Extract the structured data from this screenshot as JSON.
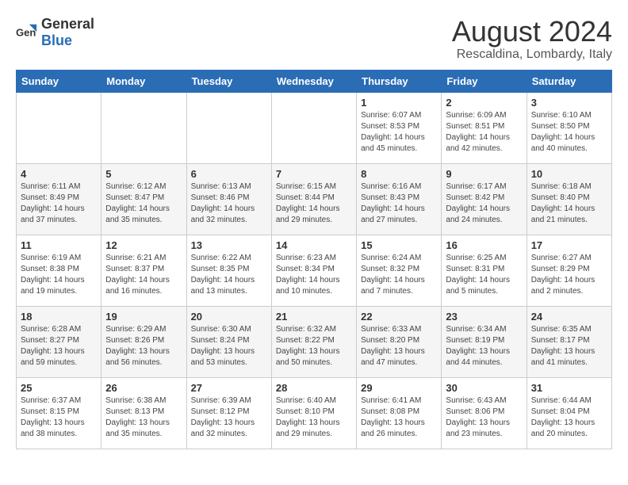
{
  "logo": {
    "general": "General",
    "blue": "Blue"
  },
  "title": "August 2024",
  "location": "Rescaldina, Lombardy, Italy",
  "days_header": [
    "Sunday",
    "Monday",
    "Tuesday",
    "Wednesday",
    "Thursday",
    "Friday",
    "Saturday"
  ],
  "weeks": [
    [
      {
        "day": "",
        "info": ""
      },
      {
        "day": "",
        "info": ""
      },
      {
        "day": "",
        "info": ""
      },
      {
        "day": "",
        "info": ""
      },
      {
        "day": "1",
        "info": "Sunrise: 6:07 AM\nSunset: 8:53 PM\nDaylight: 14 hours\nand 45 minutes."
      },
      {
        "day": "2",
        "info": "Sunrise: 6:09 AM\nSunset: 8:51 PM\nDaylight: 14 hours\nand 42 minutes."
      },
      {
        "day": "3",
        "info": "Sunrise: 6:10 AM\nSunset: 8:50 PM\nDaylight: 14 hours\nand 40 minutes."
      }
    ],
    [
      {
        "day": "4",
        "info": "Sunrise: 6:11 AM\nSunset: 8:49 PM\nDaylight: 14 hours\nand 37 minutes."
      },
      {
        "day": "5",
        "info": "Sunrise: 6:12 AM\nSunset: 8:47 PM\nDaylight: 14 hours\nand 35 minutes."
      },
      {
        "day": "6",
        "info": "Sunrise: 6:13 AM\nSunset: 8:46 PM\nDaylight: 14 hours\nand 32 minutes."
      },
      {
        "day": "7",
        "info": "Sunrise: 6:15 AM\nSunset: 8:44 PM\nDaylight: 14 hours\nand 29 minutes."
      },
      {
        "day": "8",
        "info": "Sunrise: 6:16 AM\nSunset: 8:43 PM\nDaylight: 14 hours\nand 27 minutes."
      },
      {
        "day": "9",
        "info": "Sunrise: 6:17 AM\nSunset: 8:42 PM\nDaylight: 14 hours\nand 24 minutes."
      },
      {
        "day": "10",
        "info": "Sunrise: 6:18 AM\nSunset: 8:40 PM\nDaylight: 14 hours\nand 21 minutes."
      }
    ],
    [
      {
        "day": "11",
        "info": "Sunrise: 6:19 AM\nSunset: 8:38 PM\nDaylight: 14 hours\nand 19 minutes."
      },
      {
        "day": "12",
        "info": "Sunrise: 6:21 AM\nSunset: 8:37 PM\nDaylight: 14 hours\nand 16 minutes."
      },
      {
        "day": "13",
        "info": "Sunrise: 6:22 AM\nSunset: 8:35 PM\nDaylight: 14 hours\nand 13 minutes."
      },
      {
        "day": "14",
        "info": "Sunrise: 6:23 AM\nSunset: 8:34 PM\nDaylight: 14 hours\nand 10 minutes."
      },
      {
        "day": "15",
        "info": "Sunrise: 6:24 AM\nSunset: 8:32 PM\nDaylight: 14 hours\nand 7 minutes."
      },
      {
        "day": "16",
        "info": "Sunrise: 6:25 AM\nSunset: 8:31 PM\nDaylight: 14 hours\nand 5 minutes."
      },
      {
        "day": "17",
        "info": "Sunrise: 6:27 AM\nSunset: 8:29 PM\nDaylight: 14 hours\nand 2 minutes."
      }
    ],
    [
      {
        "day": "18",
        "info": "Sunrise: 6:28 AM\nSunset: 8:27 PM\nDaylight: 13 hours\nand 59 minutes."
      },
      {
        "day": "19",
        "info": "Sunrise: 6:29 AM\nSunset: 8:26 PM\nDaylight: 13 hours\nand 56 minutes."
      },
      {
        "day": "20",
        "info": "Sunrise: 6:30 AM\nSunset: 8:24 PM\nDaylight: 13 hours\nand 53 minutes."
      },
      {
        "day": "21",
        "info": "Sunrise: 6:32 AM\nSunset: 8:22 PM\nDaylight: 13 hours\nand 50 minutes."
      },
      {
        "day": "22",
        "info": "Sunrise: 6:33 AM\nSunset: 8:20 PM\nDaylight: 13 hours\nand 47 minutes."
      },
      {
        "day": "23",
        "info": "Sunrise: 6:34 AM\nSunset: 8:19 PM\nDaylight: 13 hours\nand 44 minutes."
      },
      {
        "day": "24",
        "info": "Sunrise: 6:35 AM\nSunset: 8:17 PM\nDaylight: 13 hours\nand 41 minutes."
      }
    ],
    [
      {
        "day": "25",
        "info": "Sunrise: 6:37 AM\nSunset: 8:15 PM\nDaylight: 13 hours\nand 38 minutes."
      },
      {
        "day": "26",
        "info": "Sunrise: 6:38 AM\nSunset: 8:13 PM\nDaylight: 13 hours\nand 35 minutes."
      },
      {
        "day": "27",
        "info": "Sunrise: 6:39 AM\nSunset: 8:12 PM\nDaylight: 13 hours\nand 32 minutes."
      },
      {
        "day": "28",
        "info": "Sunrise: 6:40 AM\nSunset: 8:10 PM\nDaylight: 13 hours\nand 29 minutes."
      },
      {
        "day": "29",
        "info": "Sunrise: 6:41 AM\nSunset: 8:08 PM\nDaylight: 13 hours\nand 26 minutes."
      },
      {
        "day": "30",
        "info": "Sunrise: 6:43 AM\nSunset: 8:06 PM\nDaylight: 13 hours\nand 23 minutes."
      },
      {
        "day": "31",
        "info": "Sunrise: 6:44 AM\nSunset: 8:04 PM\nDaylight: 13 hours\nand 20 minutes."
      }
    ]
  ]
}
